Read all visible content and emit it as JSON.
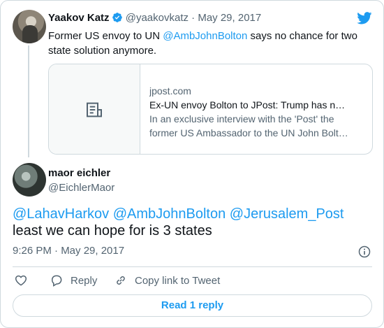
{
  "quoted_tweet": {
    "name": "Yaakov Katz",
    "handle": "@yaakovkatz",
    "separator": "·",
    "date": "May 29, 2017",
    "text_before": "Former US envoy to UN ",
    "mention": "@AmbJohnBolton",
    "text_after": " says no chance for two state solution anymore."
  },
  "link_card": {
    "domain": "jpost.com",
    "title": "Ex-UN envoy Bolton to JPost: Trump has n…",
    "description_line1": "In an exclusive interview with the 'Post' the",
    "description_line2": "former US Ambassador to the UN John Bolt…"
  },
  "main_tweet": {
    "name": "maor eichler",
    "handle": "@EichlerMaor",
    "mentions": "@LahavHarkov @AmbJohnBolton @Jerusalem_Post",
    "text": "least we can hope for is 3 states",
    "time": "9:26 PM · May 29, 2017"
  },
  "actions": {
    "reply_label": "Reply",
    "copy_label": "Copy link to Tweet",
    "read_replies_label": "Read 1 reply"
  },
  "colors": {
    "accent": "#1d9bf0",
    "muted": "#536471",
    "border": "#cfd9de"
  },
  "icons": {
    "brand": "twitter-bird-icon",
    "verified": "verified-badge-icon",
    "link_thumb": "document-icon",
    "info": "info-icon",
    "like": "heart-icon",
    "reply": "reply-icon",
    "copy": "link-icon"
  }
}
